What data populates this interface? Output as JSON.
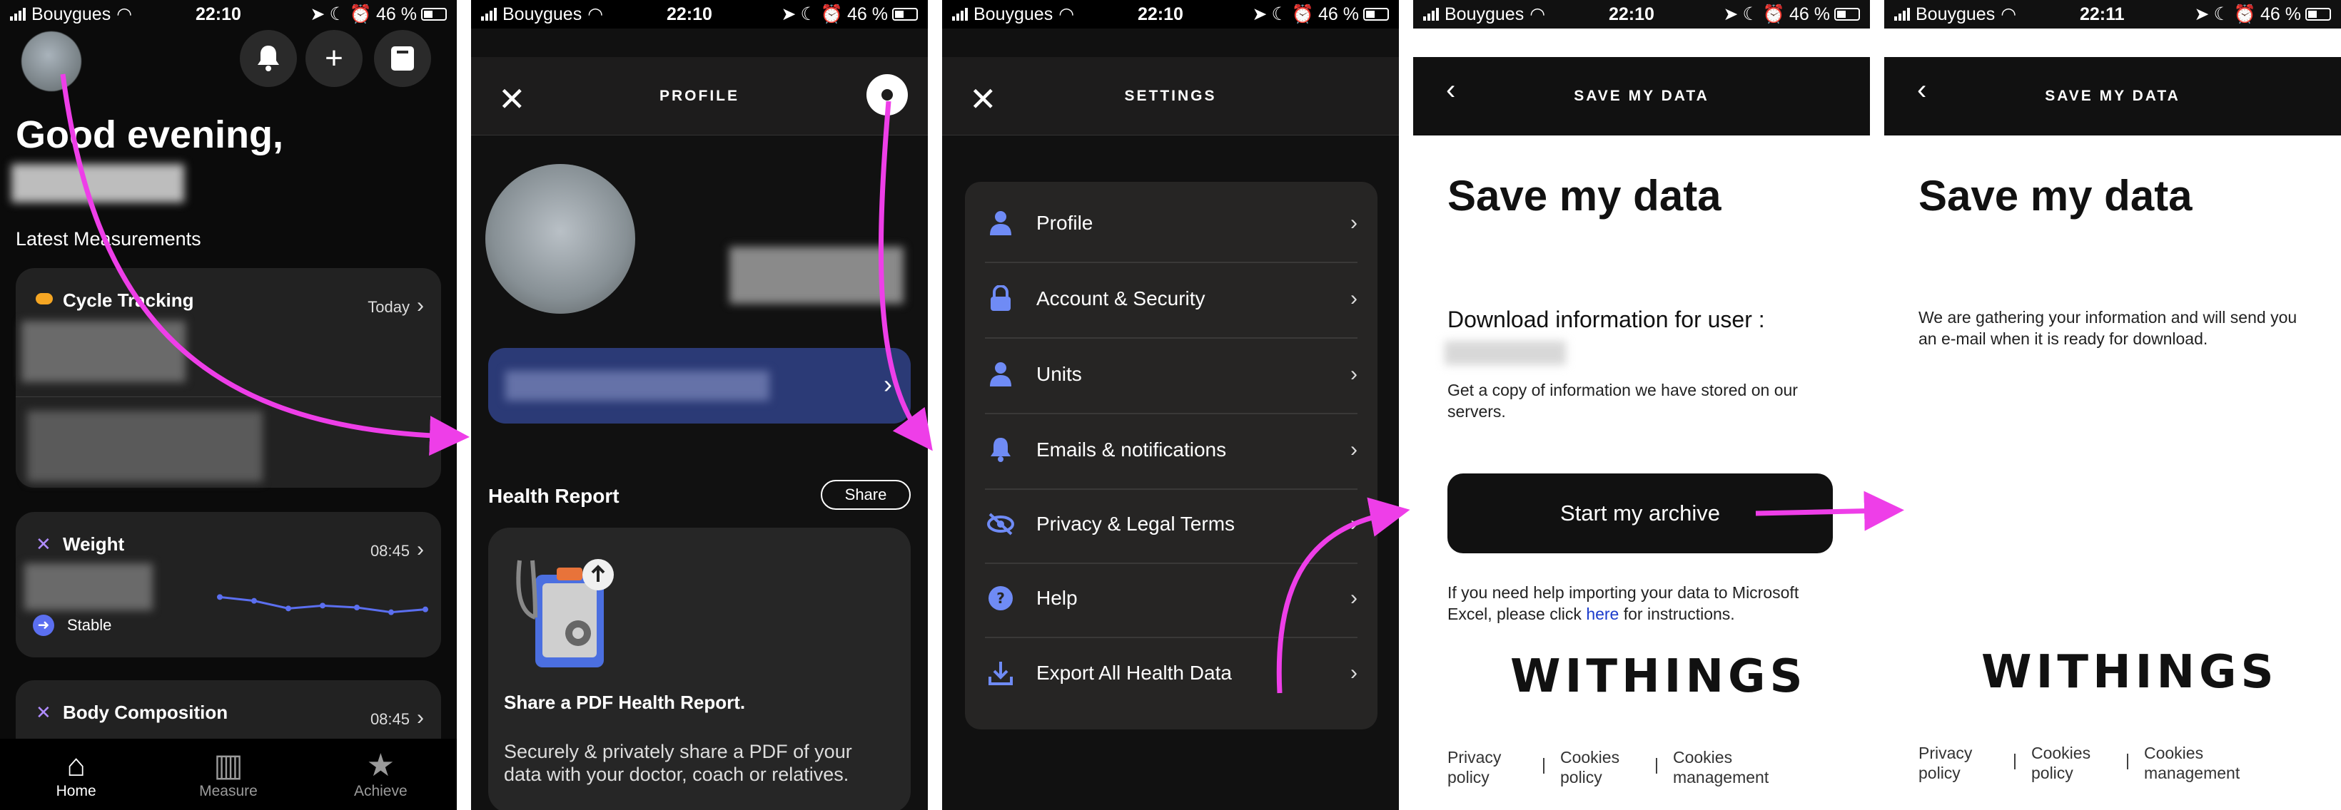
{
  "status_bars": [
    {
      "carrier": "Bouygues",
      "time": "22:10",
      "battery": "46 %"
    },
    {
      "carrier": "Bouygues",
      "time": "22:10",
      "battery": "46 %"
    },
    {
      "carrier": "Bouygues",
      "time": "22:10",
      "battery": "46 %"
    },
    {
      "carrier": "Bouygues",
      "time": "22:10",
      "battery": "46 %"
    },
    {
      "carrier": "Bouygues",
      "time": "22:11",
      "battery": "46 %"
    }
  ],
  "home": {
    "greeting": "Good evening,",
    "latest_label": "Latest Measurements",
    "cycle": {
      "title": "Cycle Tracking",
      "meta": "Today"
    },
    "weight": {
      "title": "Weight",
      "meta": "08:45",
      "trend": "Stable",
      "sparkline": [
        5,
        4.6,
        3.8,
        4.1,
        3.9,
        3.4,
        3.7
      ]
    },
    "body": {
      "title": "Body Composition",
      "meta": "08:45"
    },
    "tabs": [
      {
        "label": "Home",
        "icon": "home-icon"
      },
      {
        "label": "Measure",
        "icon": "chart-icon"
      },
      {
        "label": "Achieve",
        "icon": "star-icon"
      }
    ]
  },
  "profile": {
    "header": "PROFILE",
    "health_report_title": "Health Report",
    "share_label": "Share",
    "card_title": "Share a PDF Health Report.",
    "card_body": "Securely & privately share a PDF of your data with your doctor, coach or relatives."
  },
  "settings": {
    "header": "SETTINGS",
    "items": [
      {
        "label": "Profile",
        "icon": "person-icon"
      },
      {
        "label": "Account & Security",
        "icon": "lock-icon"
      },
      {
        "label": "Units",
        "icon": "person-icon"
      },
      {
        "label": "Emails & notifications",
        "icon": "bell-icon"
      },
      {
        "label": "Privacy & Legal Terms",
        "icon": "eye-slash-icon"
      },
      {
        "label": "Help",
        "icon": "help-icon"
      },
      {
        "label": "Export All Health Data",
        "icon": "download-icon"
      }
    ]
  },
  "save_data": {
    "header": "SAVE MY DATA",
    "title": "Save my data",
    "download_label": "Download information for user :",
    "copy_text": "Get a copy of information we have stored on our servers.",
    "button": "Start my archive",
    "help_before": "If you need help importing your data to Microsoft Excel, please click ",
    "help_link": "here",
    "help_after": " for instructions.",
    "logo": "WITHINGS",
    "footer": [
      "Privacy policy",
      "Cookies policy",
      "Cookies management"
    ]
  },
  "save_data_done": {
    "header": "SAVE MY DATA",
    "title": "Save my data",
    "message": "We are gathering your information and will send you an e-mail when it is ready for download.",
    "logo": "WITHINGS",
    "footer": [
      "Privacy policy",
      "Cookies policy",
      "Cookies management"
    ]
  },
  "colors": {
    "accent_arrow": "#ee3ee8",
    "promo_blue": "#2b3a76",
    "icon_blue": "#6f8bf5",
    "link_blue": "#1c3ccc"
  }
}
